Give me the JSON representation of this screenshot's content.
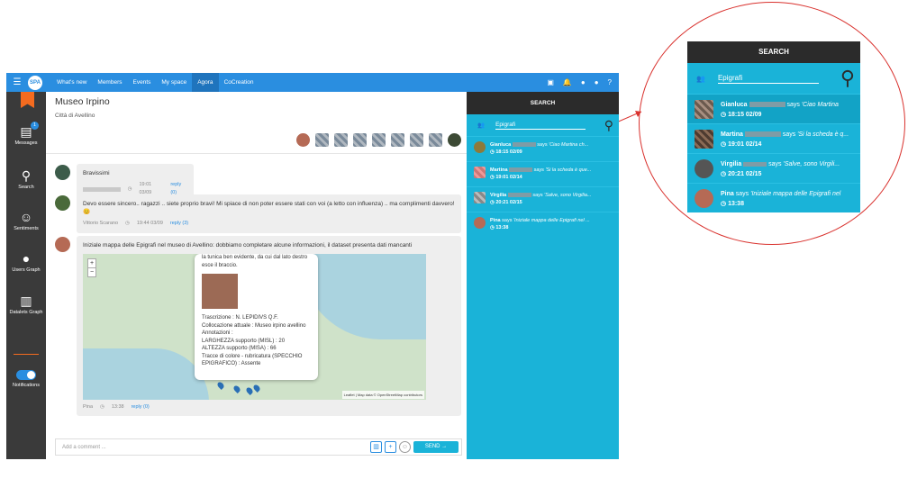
{
  "nav": {
    "items": [
      "What's new",
      "Members",
      "Events",
      "My space",
      "Agora",
      "CoCreation"
    ],
    "active": "Agora",
    "logo_text": "SPA"
  },
  "sidebar": {
    "items": [
      {
        "label": "Messages",
        "icon": "messages-icon",
        "badge": "1"
      },
      {
        "label": "Search",
        "icon": "search-icon"
      },
      {
        "label": "Sentiments",
        "icon": "smile-icon"
      },
      {
        "label": "Users Graph",
        "icon": "user-icon"
      },
      {
        "label": "Datalets Graph",
        "icon": "bar-chart-icon"
      },
      {
        "label": "Notifications",
        "icon": "toggle-icon"
      }
    ]
  },
  "room": {
    "title": "Museo Irpino",
    "subtitle": "Città di Avellino"
  },
  "posts": [
    {
      "text": "Bravissimi",
      "time": "19:01 03/09",
      "reply": "reply (0)"
    },
    {
      "text": "Devo essere sincero.. ragazzi .. siete proprio bravi! Mi spiace di non poter essere stati con voi (a letto con influenza) .. ma complimenti davvero! 😊",
      "author": "Vittorio Scarano",
      "time": "19:44 03/09",
      "reply": "reply (3)"
    },
    {
      "text": "Iniziale mappa delle Epigrafi nel museo di Avellino: dobbiamo completare alcune informazioni, il dataset presenta dati mancanti",
      "author": "Pina",
      "time": "13:38",
      "reply": "reply (0)"
    }
  ],
  "map": {
    "zoom_in": "+",
    "zoom_out": "−",
    "attribution": "Leaflet | Map data © OpenStreetMap contributors",
    "popup": [
      "la tunica ben evidente, da cui dal lato destro esce il braccio.",
      "Trascrizione : N. LEPIDIVS Q.F.",
      "Collocazione attuale : Museo irpino avellino",
      "Annotazioni :",
      "LARGHEZZA supporto (MISL) : 20",
      "ALTEZZA supporto (MISA) : 66",
      "Tracce di colore - rubricatura (SPECCHIO EPIGRAFICO) : Assente"
    ]
  },
  "composer": {
    "placeholder": "Add a comment ...",
    "send": "SEND"
  },
  "search_panel": {
    "title": "SEARCH",
    "query": "Epigrafi",
    "results": [
      {
        "name": "Gianluca",
        "says": "says",
        "quote": "'Ciao Martina ch...",
        "time": "18:15 02/09"
      },
      {
        "name": "Martina",
        "says": "says",
        "quote": "'Si la scheda è que...",
        "time": "19:01 02/14"
      },
      {
        "name": "Virgilia",
        "says": "says",
        "quote": "'Salve, sono Virgilia...",
        "time": "20:21 02/15"
      },
      {
        "name": "Pina",
        "says": "says",
        "quote": "'Iniziale mappa delle Epigrafi nel ...",
        "time": "13:38"
      }
    ]
  },
  "zoom_panel": {
    "title": "SEARCH",
    "query": "Epigrafi",
    "results": [
      {
        "name": "Gianluca",
        "says": "says",
        "quote": "'Ciao Martina",
        "time": "18:15 02/09"
      },
      {
        "name": "Martina",
        "says": "says",
        "quote": "'Si la scheda è q...",
        "time": "19:01 02/14"
      },
      {
        "name": "Virgilia",
        "says": "says",
        "quote": "'Salve, sono Virgili...",
        "time": "20:21 02/15"
      },
      {
        "name": "Pina",
        "says": "says",
        "quote": "'Iniziale mappa delle Epigrafi nel",
        "time": "13:38"
      }
    ]
  },
  "colors": {
    "accent": "#2a8ee0",
    "panel": "#1ab3d8",
    "sidebar": "#3a3a3a",
    "orange": "#f46b1f",
    "callout": "#d9322e"
  }
}
